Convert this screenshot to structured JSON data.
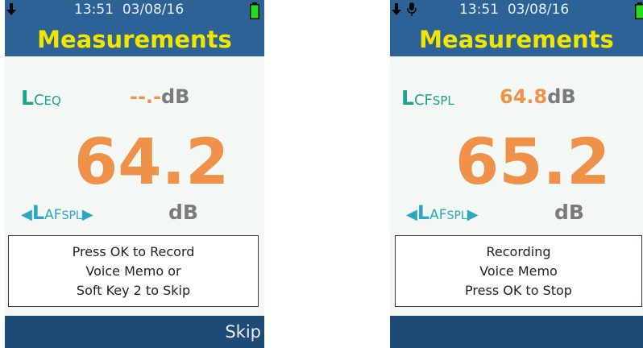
{
  "screens": [
    {
      "time": "13:51",
      "date": "03/08/16",
      "title": "Measurements",
      "lc": {
        "prefix": "L",
        "mid": "C",
        "sub": "EQ",
        "value": "--.-",
        "unit": "dB"
      },
      "main_value": "64.2",
      "laf": {
        "left_arrow": "◀",
        "prefix": "L",
        "mid": "AF",
        "sub": "SPL",
        "right_arrow": "▶",
        "unit": "dB"
      },
      "dialog_lines": [
        "Press OK to Record",
        "Voice Memo or",
        "Soft Key 2 to Skip"
      ],
      "softkey": "Skip",
      "icons": [
        "download-arrow-icon",
        "battery-icon"
      ]
    },
    {
      "time": "13:51",
      "date": "03/08/16",
      "title": "Measurements",
      "lc": {
        "prefix": "L",
        "mid": "CF",
        "sub": "SPL",
        "value": "64.8",
        "unit": "dB"
      },
      "main_value": "65.2",
      "laf": {
        "left_arrow": "◀",
        "prefix": "L",
        "mid": "AF",
        "sub": "SPL",
        "right_arrow": "▶",
        "unit": "dB"
      },
      "dialog_lines": [
        "Recording",
        "Voice Memo",
        "Press OK to Stop"
      ],
      "icons": [
        "download-arrow-icon",
        "microphone-icon",
        "battery-icon"
      ]
    }
  ],
  "colors": {
    "header": "#2c6295",
    "title": "#f2e500",
    "lc_label": "#1ca48a",
    "value": "#f0914a",
    "unit": "#7b7b7b",
    "laf": "#2ea6c2",
    "battery": "#22dd22",
    "footer": "#1e4a76"
  }
}
